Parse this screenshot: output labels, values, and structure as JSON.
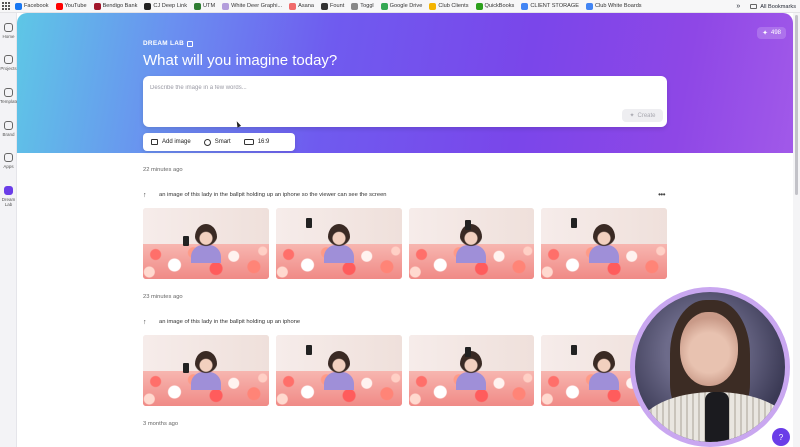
{
  "bookmarks": [
    {
      "label": "Facebook",
      "color": "#1877f2"
    },
    {
      "label": "YouTube",
      "color": "#ff0000"
    },
    {
      "label": "Bendigo Bank",
      "color": "#a1162b"
    },
    {
      "label": "CJ Deep Link",
      "color": "#222222"
    },
    {
      "label": "UTM",
      "color": "#2e7d32"
    },
    {
      "label": "White Deer Graphi...",
      "color": "#b39ddb"
    },
    {
      "label": "Asana",
      "color": "#f06a6a"
    },
    {
      "label": "Fount",
      "color": "#333333"
    },
    {
      "label": "Toggl",
      "color": "#888888"
    },
    {
      "label": "Google Drive",
      "color": "#34a853"
    },
    {
      "label": "Club Clients",
      "color": "#f4b400"
    },
    {
      "label": "QuickBooks",
      "color": "#2ca01c"
    },
    {
      "label": "CLIENT STORAGE",
      "color": "#4285f4"
    },
    {
      "label": "Club White Boards",
      "color": "#4285f4"
    }
  ],
  "bookmarks_right": {
    "chevron": "»",
    "all_label": "All Bookmarks"
  },
  "rail": [
    {
      "label": "Home",
      "icon": "home-icon"
    },
    {
      "label": "Projects",
      "icon": "folder-icon"
    },
    {
      "label": "Templates",
      "icon": "templates-icon"
    },
    {
      "label": "Brand",
      "icon": "brand-icon"
    },
    {
      "label": "Apps",
      "icon": "apps-icon"
    },
    {
      "label": "Dream Lab",
      "icon": "dream-lab-icon",
      "active": true
    }
  ],
  "hero": {
    "tag": "DREAM LAB",
    "title": "What will you imagine today?",
    "credits": "498"
  },
  "prompt": {
    "placeholder": "Describe the image in a few words...",
    "create_label": "Create"
  },
  "options": {
    "add_image": "Add image",
    "style": "Smart",
    "ratio": "16:9"
  },
  "history": [
    {
      "time": "22 minutes ago",
      "prompt": "an image of this lady in the ballpit holding up an iphone so the viewer can see the screen",
      "count": 4
    },
    {
      "time": "23 minutes ago",
      "prompt": "an image of this lady in the ballpit holding up an iphone",
      "count": 4
    },
    {
      "time": "3 months ago",
      "prompt": "",
      "count": 0
    }
  ],
  "help_label": "?",
  "colors": {
    "accent": "#6a3de8",
    "webcam_ring": "#c9a7f0"
  }
}
